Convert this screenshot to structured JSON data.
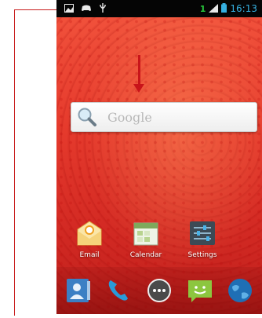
{
  "status_bar": {
    "icons": [
      "photo-icon",
      "game-controller-icon",
      "usb-icon"
    ],
    "notification_count": "1",
    "time": "16:13"
  },
  "search_widget": {
    "placeholder": "Google",
    "icon": "search-icon"
  },
  "home_apps": [
    {
      "label": "Email",
      "icon": "email-icon"
    },
    {
      "label": "Calendar",
      "icon": "calendar-icon"
    },
    {
      "label": "Settings",
      "icon": "settings-icon"
    }
  ],
  "dock": [
    {
      "icon": "contacts-icon"
    },
    {
      "icon": "phone-icon"
    },
    {
      "icon": "app-drawer-icon"
    },
    {
      "icon": "messaging-icon"
    },
    {
      "icon": "browser-icon"
    }
  ],
  "colors": {
    "wallpaper_base": "#e63b2d",
    "callout_red": "#c81e1e",
    "status_time": "#36b0e0",
    "status_count": "#27c43a"
  }
}
